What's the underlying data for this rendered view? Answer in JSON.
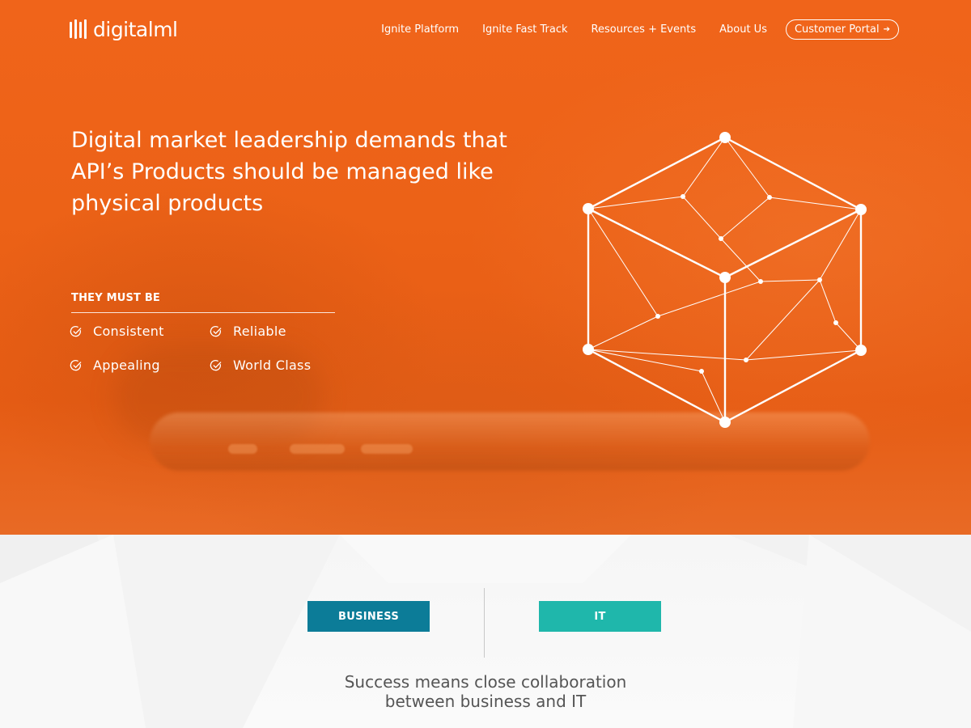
{
  "brand": {
    "name": "digitalml"
  },
  "nav": {
    "links": [
      "Ignite Platform",
      "Ignite Fast Track",
      "Resources + Events",
      "About Us"
    ],
    "cta": "Customer Portal",
    "cta_arrow": "➔"
  },
  "hero": {
    "headline": "Digital market leadership demands that API’s Products should be managed like physical products",
    "must_label": "THEY MUST BE",
    "qualities": [
      "Consistent",
      "Reliable",
      "Appealing",
      "World Class"
    ]
  },
  "collab": {
    "business_label": "BUSINESS",
    "it_label": "IT",
    "tagline_line1": "Success means close collaboration",
    "tagline_line2": "between business and IT"
  },
  "colors": {
    "hero_orange": "#ec6217",
    "business_blue": "#0c7c98",
    "it_teal": "#1fb7ab",
    "tagline_gray": "#555555"
  },
  "icons": {
    "logo": "bars-logo-icon",
    "quality_check": "check-circle-icon",
    "cta_arrow": "arrow-right-icon",
    "hero_graphic": "cube-network-icon"
  }
}
